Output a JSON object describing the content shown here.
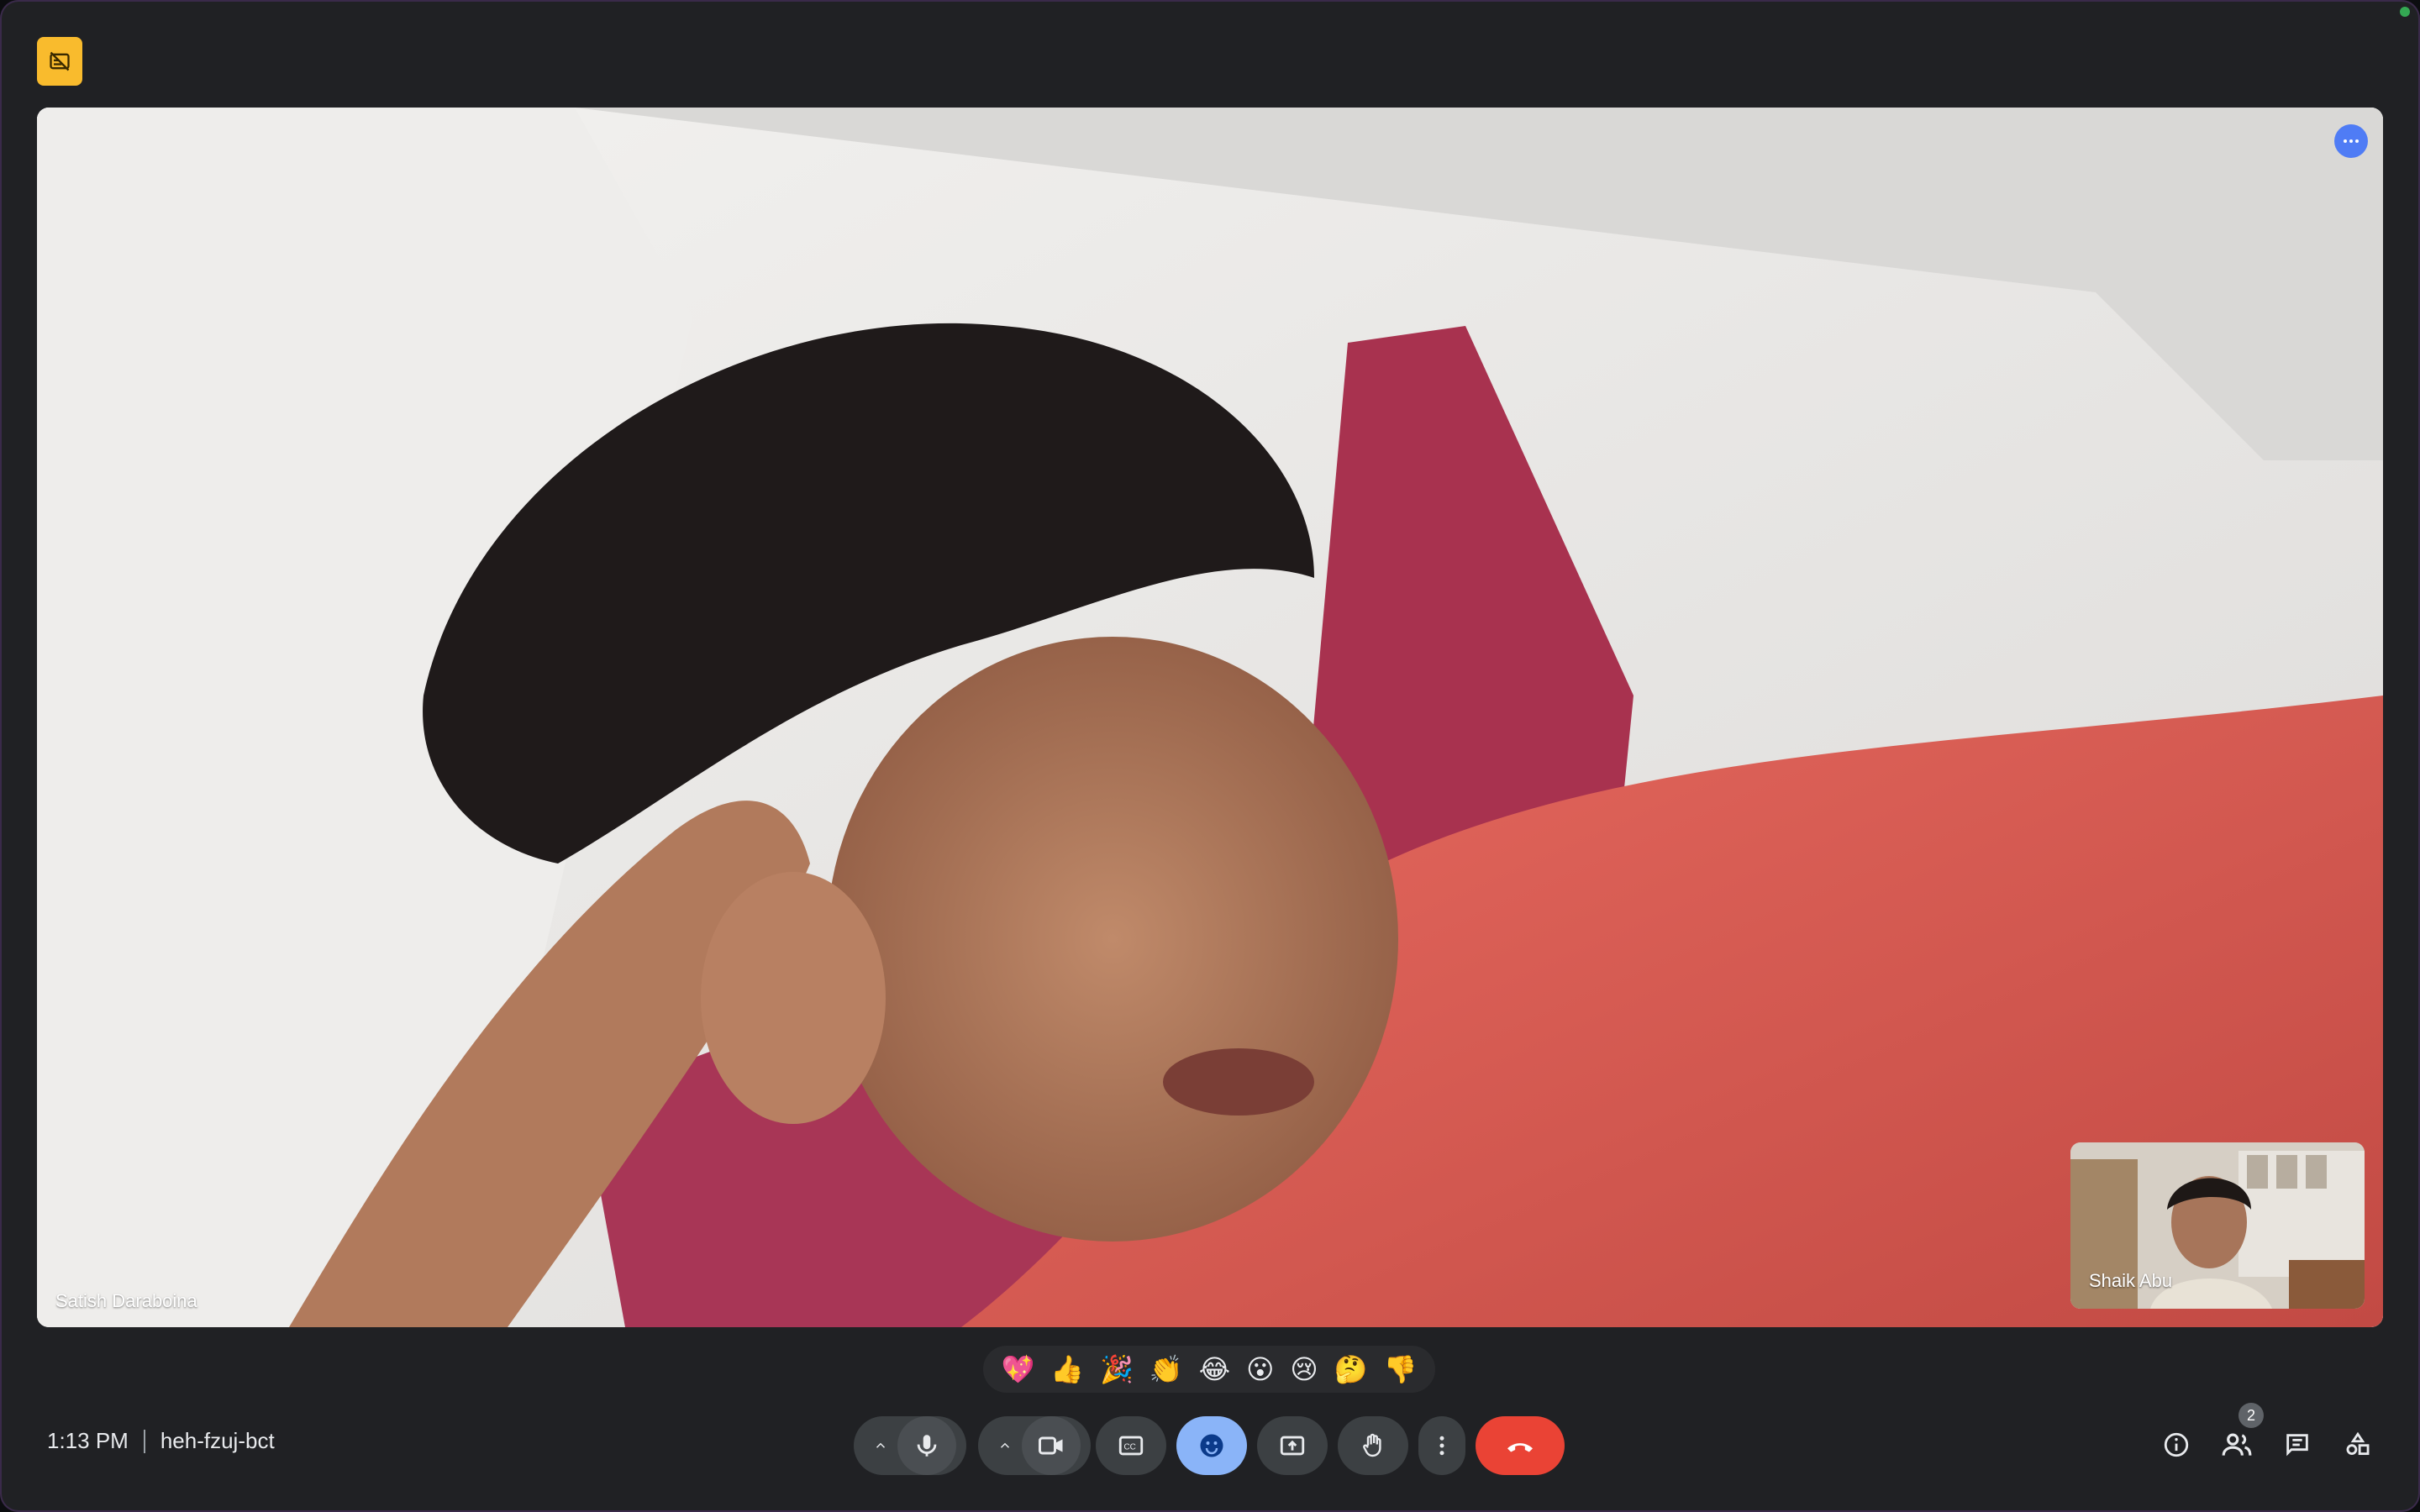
{
  "meeting": {
    "time": "1:13 PM",
    "code": "heh-fzuj-bct"
  },
  "participants": {
    "main_name": "Satish Daraboina",
    "pip_name": "Shaik Abu",
    "count": "2"
  },
  "reactions": [
    "💖",
    "👍",
    "🎉",
    "👏",
    "😂",
    "😮",
    "😢",
    "🤔",
    "👎"
  ],
  "colors": {
    "background": "#202124",
    "control": "#3c4043",
    "active_control": "#8ab4f8",
    "end_call": "#ea4335",
    "badge": "#f9bb2d",
    "more_button": "#4f7cf5"
  },
  "icons": {
    "badge": "captions-off-icon",
    "mic": "mic-icon",
    "camera": "camera-icon",
    "captions": "captions-icon",
    "emoji": "emoji-icon",
    "present": "present-icon",
    "raise_hand": "raise-hand-icon",
    "more": "more-vert-icon",
    "end_call": "end-call-icon",
    "info": "info-icon",
    "people": "people-icon",
    "chat": "chat-icon",
    "activities": "activities-icon"
  }
}
